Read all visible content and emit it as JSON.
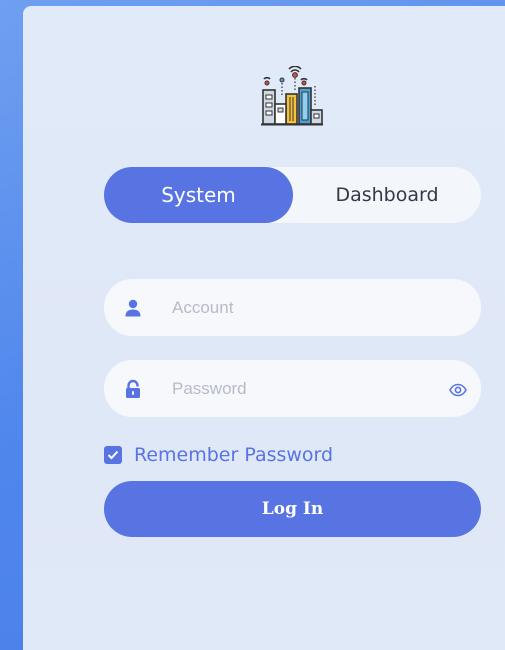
{
  "logo": {
    "icon": "city-buildings-icon"
  },
  "tabs": [
    {
      "label": "System",
      "active": true
    },
    {
      "label": "Dashboard",
      "active": false
    }
  ],
  "form": {
    "account": {
      "icon": "user-icon",
      "placeholder": "Account",
      "value": ""
    },
    "password": {
      "icon": "lock-icon",
      "placeholder": "Password",
      "value": "",
      "toggle_icon": "eye-icon"
    },
    "remember": {
      "label": "Remember Password",
      "checked": true
    },
    "submit_label": "Log In"
  },
  "colors": {
    "accent": "#5873e2",
    "background": "#4f86ec",
    "card": "#e0e9f8",
    "field": "#f6f8fc"
  }
}
